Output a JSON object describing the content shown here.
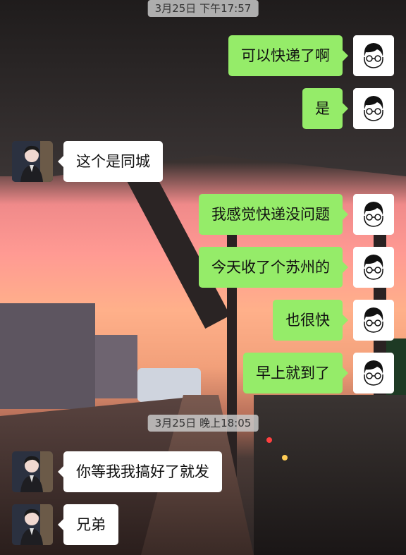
{
  "colors": {
    "self_bubble": "#95ec69",
    "other_bubble": "#ffffff",
    "timestamp_bg": "#c8c8c8"
  },
  "messages": [
    {
      "type": "time",
      "text": "3月25日 下午17:57"
    },
    {
      "type": "msg",
      "side": "right",
      "text": "可以快递了啊",
      "avatar": "cartoon-boy-glasses"
    },
    {
      "type": "msg",
      "side": "right",
      "text": "是",
      "avatar": "cartoon-boy-glasses"
    },
    {
      "type": "msg",
      "side": "left",
      "text": "这个是同城",
      "avatar": "photo-person"
    },
    {
      "type": "msg",
      "side": "right",
      "text": "我感觉快递没问题",
      "avatar": "cartoon-boy-glasses"
    },
    {
      "type": "msg",
      "side": "right",
      "text": "今天收了个苏州的",
      "avatar": "cartoon-boy-glasses"
    },
    {
      "type": "msg",
      "side": "right",
      "text": "也很快",
      "avatar": "cartoon-boy-glasses"
    },
    {
      "type": "msg",
      "side": "right",
      "text": "早上就到了",
      "avatar": "cartoon-boy-glasses"
    },
    {
      "type": "time",
      "text": "3月25日 晚上18:05"
    },
    {
      "type": "msg",
      "side": "left",
      "text": "你等我我搞好了就发",
      "avatar": "photo-person"
    },
    {
      "type": "msg",
      "side": "left",
      "text": "兄弟",
      "avatar": "photo-person"
    }
  ]
}
